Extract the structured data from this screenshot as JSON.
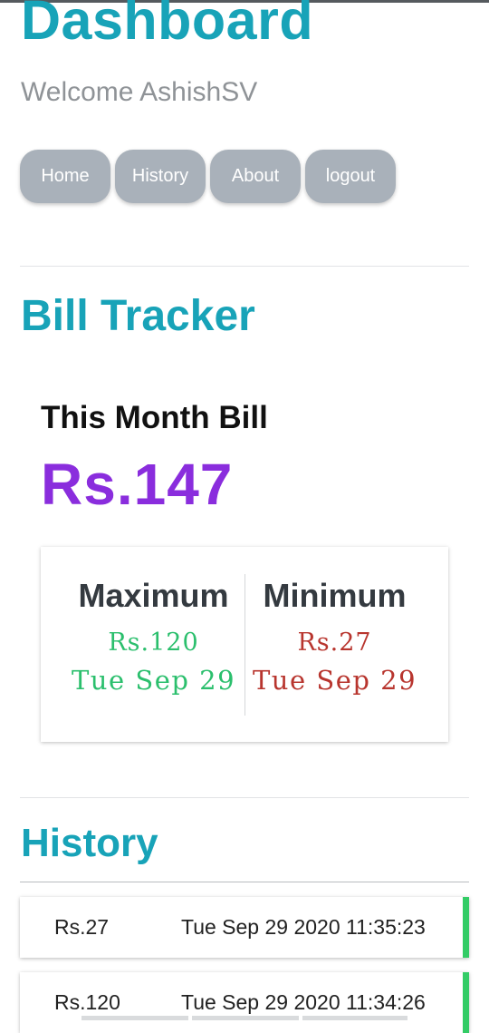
{
  "header": {
    "title": "Dashboard",
    "welcome": "Welcome AshishSV"
  },
  "nav": {
    "home": "Home",
    "history": "History",
    "about": "About",
    "logout": "logout"
  },
  "bill": {
    "section_title": "Bill Tracker",
    "month_label": "This Month Bill",
    "month_value": "Rs.147"
  },
  "stats": {
    "max_label": "Maximum",
    "max_amount": "Rs.120",
    "max_date": "Tue Sep 29",
    "min_label": "Minimum",
    "min_amount": "Rs.27",
    "min_date": "Tue Sep 29"
  },
  "history": {
    "section_title": "History",
    "entries": [
      {
        "amount": "Rs.27",
        "timestamp": "Tue Sep 29 2020 11:35:23"
      },
      {
        "amount": "Rs.120",
        "timestamp": "Tue Sep 29 2020 11:34:26"
      }
    ]
  },
  "colors": {
    "accent": "#18a3b8",
    "bill_value": "#8a2ddd",
    "max": "#2bbf6d",
    "min": "#b8352e",
    "nav_button": "#a9b1ba",
    "history_marker": "#33cc66"
  }
}
